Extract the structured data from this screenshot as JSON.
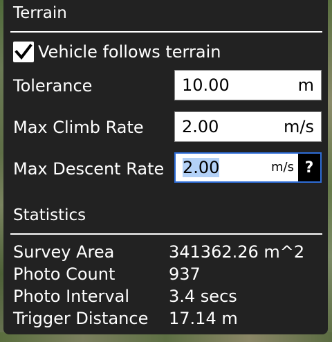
{
  "terrain": {
    "title": "Terrain",
    "follow_terrain": {
      "label": "Vehicle follows terrain",
      "checked": true
    },
    "fields": [
      {
        "label": "Tolerance",
        "value": "10.00",
        "unit": "m"
      },
      {
        "label": "Max Climb Rate",
        "value": "2.00",
        "unit": "m/s"
      },
      {
        "label": "Max Descent Rate",
        "value": "2.00",
        "unit": "m/s",
        "help": "?"
      }
    ]
  },
  "statistics": {
    "title": "Statistics",
    "rows": [
      {
        "label": "Survey Area",
        "value": "341362.26 m^2"
      },
      {
        "label": "Photo Count",
        "value": "937"
      },
      {
        "label": "Photo Interval",
        "value": "3.4 secs"
      },
      {
        "label": "Trigger Distance",
        "value": "17.14 m"
      }
    ]
  },
  "colors": {
    "panel_bg": "#222222",
    "text": "#ffffff",
    "focus_border": "#2e6dd8",
    "selection": "#b3d1f7"
  }
}
